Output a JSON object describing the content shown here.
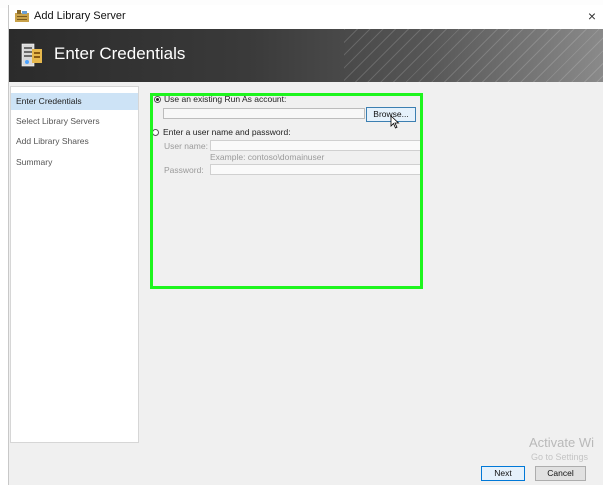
{
  "window": {
    "title": "Add Library Server",
    "close_glyph": "×",
    "app_icon": "library-server-icon"
  },
  "header": {
    "title": "Enter Credentials",
    "icon": "credentials-server-icon"
  },
  "nav": {
    "items": [
      {
        "label": "Enter Credentials",
        "active": true
      },
      {
        "label": "Select Library Servers",
        "active": false
      },
      {
        "label": "Add Library Shares",
        "active": false
      },
      {
        "label": "Summary",
        "active": false
      }
    ]
  },
  "credentials": {
    "runas_option_label": "Use an existing Run As account:",
    "runas_value": "",
    "browse_label": "Browse...",
    "manual_option_label": "Enter a user name and password:",
    "username_label": "User name:",
    "username_value": "",
    "username_example": "Example: contoso\\domainuser",
    "password_label": "Password:",
    "password_value": ""
  },
  "watermark": {
    "line1": "Activate Wi",
    "line2": "Go to Settings"
  },
  "footer": {
    "next_label": "Next",
    "cancel_label": "Cancel"
  },
  "colors": {
    "highlight": "#1ef51e",
    "selected_nav": "#cde3f6",
    "button_focus": "#0078d7"
  }
}
